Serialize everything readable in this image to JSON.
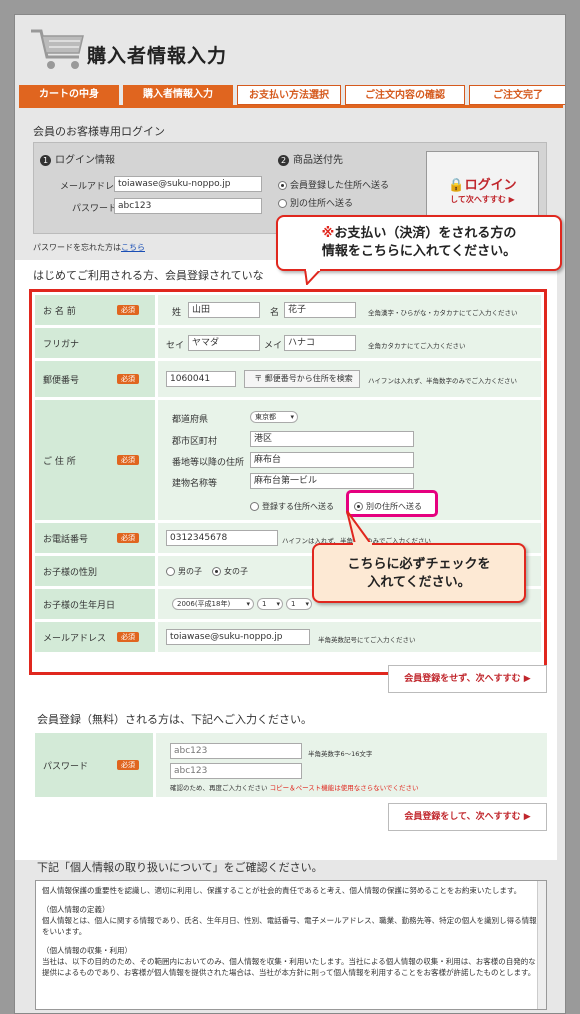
{
  "header": {
    "title": "購入者情報入力"
  },
  "steps": [
    "カートの中身",
    "購入者情報入力",
    "お支払い方法選択",
    "ご注文内容の確認",
    "ご注文完了"
  ],
  "login": {
    "section_title": "会員のお客様専用ログイン",
    "info_title": "ログイン情報",
    "info_num": "1",
    "email_label": "メールアドレス",
    "email_value": "toiawase@suku-noppo.jp",
    "password_label": "パスワード",
    "password_value": "abc123",
    "ship_title": "商品送付先",
    "ship_num": "2",
    "ship_opt1": "会員登録した住所へ送る",
    "ship_opt2": "別の住所へ送る",
    "login_label": "ログイン",
    "login_sub": "して次へすすむ ▶",
    "forgot_text": "パスワードを忘れた方は",
    "forgot_link": "こちら"
  },
  "callout_top": {
    "line1": "※お支払い（決済）をされる方の",
    "line2": "情報をこちらに入れてください。",
    "mark": "※"
  },
  "first_time": "はじめてご利用される方、会員登録されていな",
  "required_badge": "必須",
  "form": {
    "name": {
      "label": "お 名 前",
      "sei_label": "姓",
      "sei": "山田",
      "mei_label": "名",
      "mei": "花子",
      "note": "全角漢字・ひらがな・カタカナにてご入力ください"
    },
    "kana": {
      "label": "フリガナ",
      "sei_label": "セイ",
      "sei": "ヤマダ",
      "mei_label": "メイ",
      "mei": "ハナコ",
      "note": "全角カタカナにてご入力ください"
    },
    "postal": {
      "label": "郵便番号",
      "value": "1060041",
      "button": "〒 郵便番号から住所を検索",
      "note": "ハイフンは入れず、半角数字のみでご入力ください"
    },
    "address": {
      "label": "ご 住 所",
      "pref_label": "都道府県",
      "pref": "東京都",
      "city_label": "郡市区町村",
      "city": "港区",
      "street_label": "番地等以降の住所",
      "street": "麻布台",
      "bldg_label": "建物名称等",
      "bldg": "麻布台第一ビル",
      "opt1": "登録する住所へ送る",
      "opt2": "別の住所へ送る"
    },
    "phone": {
      "label": "お電話番号",
      "value": "0312345678",
      "note": "ハイフンは入れず、半角数字のみでご入力ください"
    },
    "gender": {
      "label": "お子様の性別",
      "opt1": "男の子",
      "opt2": "女の子"
    },
    "birth": {
      "label": "お子様の生年月日",
      "year": "2006(平成18年)",
      "month": "1",
      "day": "1"
    },
    "email": {
      "label": "メールアドレス",
      "value": "toiawase@suku-noppo.jp",
      "note": "半角英数記号にてご入力ください"
    }
  },
  "callout_mid": {
    "line1": "こちらに必ずチェックを",
    "line2": "入れてください。"
  },
  "btn_no_register": "会員登録をせず、次へすすむ ▶",
  "register": {
    "title": "会員登録（無料）される方は、下記へご入力ください。",
    "password_label": "パスワード",
    "pw1": "abc123",
    "pw2": "abc123",
    "pw_note": "半角英数字6〜16文字",
    "confirm_note": "確認のため、再度ご入力ください",
    "confirm_warn": "コピー＆ペースト機能は使用なさらないでください",
    "button": "会員登録をして、次へすすむ ▶"
  },
  "privacy": {
    "title": "下記「個人情報の取り扱いについて」をご確認ください。",
    "p1": "個人情報保護の重要性を認識し、適切に利用し、保護することが社会的責任であると考え、個人情報の保護に努めることをお約束いたします。",
    "h2": "（個人情報の定義）",
    "p2": "個人情報とは、個人に関する情報であり、氏名、生年月日、性別、電話番号、電子メールアドレス、職業、勤務先等、特定の個人を識別し得る情報をいいます。",
    "h3": "（個人情報の収集・利用）",
    "p3": "当社は、以下の目的のため、その範囲内においてのみ、個人情報を収集・利用いたします。当社による個人情報の収集・利用は、お客様の自発的な提供によるものであり、お客様が個人情報を提供された場合は、当社が本方針に則って個人情報を利用することをお客様が許諾したものとします。"
  },
  "colors": {
    "accent": "#e0651f",
    "red": "#e0271e",
    "green_header": "#d3ead7",
    "green_body": "#e8f3e9",
    "magenta": "#e5007f"
  }
}
